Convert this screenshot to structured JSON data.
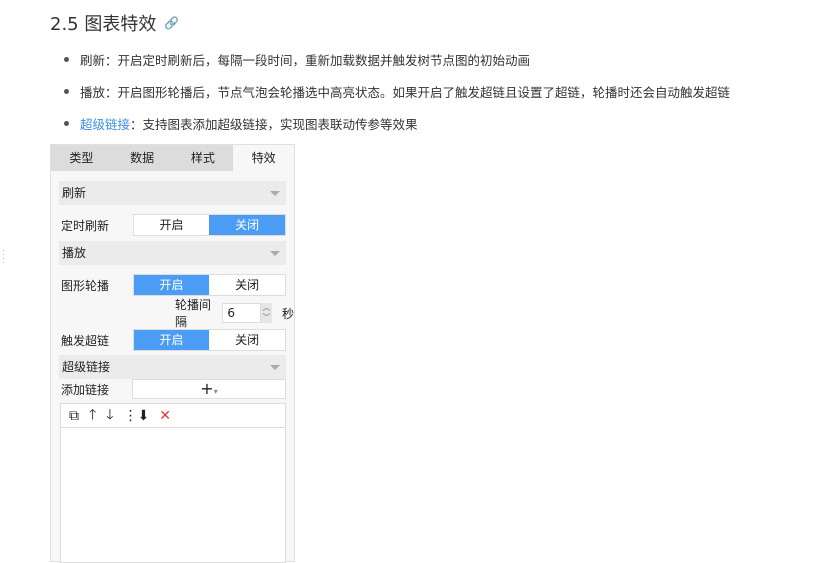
{
  "heading": {
    "title": "2.5 图表特效",
    "link_icon": "link-icon"
  },
  "bullets": [
    {
      "term": "刷新",
      "text": "：开启定时刷新后，每隔一段时间，重新加载数据并触发树节点图的初始动画"
    },
    {
      "term": "播放",
      "text": "：开启图形轮播后，节点气泡会轮播选中高亮状态。如果开启了触发超链且设置了超链，轮播时还会自动触发超链"
    },
    {
      "term": "超级链接",
      "text": "：支持图表添加超级链接，实现图表联动传参等效果"
    }
  ],
  "panel": {
    "tabs": [
      "类型",
      "数据",
      "样式",
      "特效"
    ],
    "refresh": {
      "section": "刷新",
      "label": "定时刷新",
      "on": "开启",
      "off": "关闭"
    },
    "play": {
      "section": "播放",
      "label": "图形轮播",
      "on": "开启",
      "off": "关闭",
      "interval_label": "轮播间隔",
      "interval_value": "6",
      "unit": "秒",
      "trigger_label": "触发超链",
      "trigger_on": "开启",
      "trigger_off": "关闭"
    },
    "hyperlink": {
      "section": "超级链接",
      "add_label": "添加链接",
      "add_symbol": "+",
      "toolbar_icons": [
        "copy-icon",
        "arrow-up-icon",
        "arrow-down-icon",
        "move-bottom-icon",
        "delete-icon"
      ]
    }
  }
}
